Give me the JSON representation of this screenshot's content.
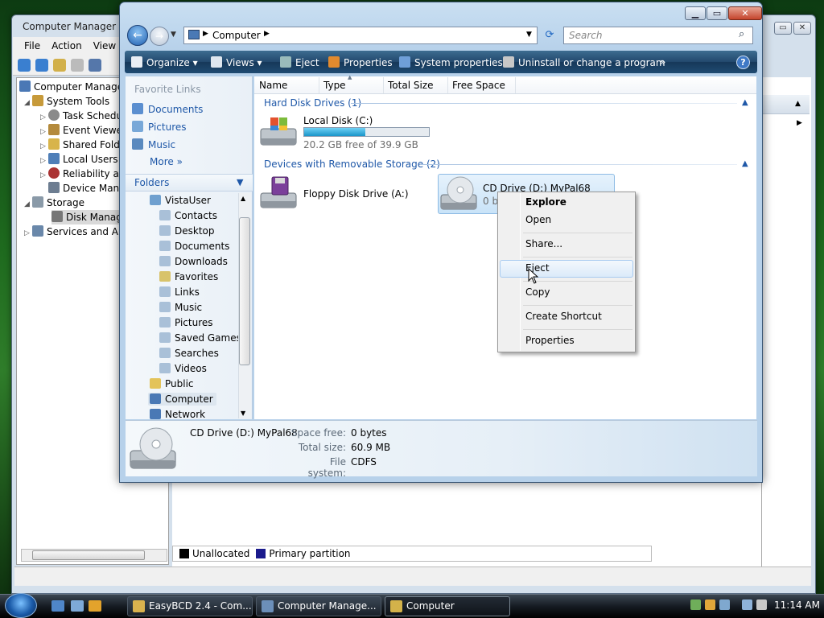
{
  "background_window": {
    "title": "Computer Manager",
    "menu": [
      "File",
      "Action",
      "View"
    ],
    "tree": [
      {
        "label": "Computer Manage",
        "level": 0
      },
      {
        "label": "System Tools",
        "level": 1
      },
      {
        "label": "Task Schedu",
        "level": 2
      },
      {
        "label": "Event Viewe",
        "level": 2
      },
      {
        "label": "Shared Fold",
        "level": 2
      },
      {
        "label": "Local Users",
        "level": 2
      },
      {
        "label": "Reliability ar",
        "level": 2
      },
      {
        "label": "Device Man",
        "level": 2
      },
      {
        "label": "Storage",
        "level": 1
      },
      {
        "label": "Disk Manag",
        "level": 2
      },
      {
        "label": "Services and Ap",
        "level": 1
      }
    ],
    "legend": [
      "Unallocated",
      "Primary partition"
    ]
  },
  "explorer": {
    "address": "Computer",
    "search_placeholder": "Search",
    "commands": [
      "Organize",
      "Views",
      "Eject",
      "Properties",
      "System properties",
      "Uninstall or change a program"
    ],
    "overflow": "»",
    "favorite_links_header": "Favorite Links",
    "favorite_links": [
      "Documents",
      "Pictures",
      "Music"
    ],
    "more_label": "More",
    "folders_label": "Folders",
    "folders": [
      "VistaUser",
      "Contacts",
      "Desktop",
      "Documents",
      "Downloads",
      "Favorites",
      "Links",
      "Music",
      "Pictures",
      "Saved Games",
      "Searches",
      "Videos",
      "Public",
      "Computer",
      "Network"
    ],
    "columns": [
      "Name",
      "Type",
      "Total Size",
      "Free Space"
    ],
    "groups": {
      "hdd": {
        "header": "Hard Disk Drives (1)",
        "drive_name": "Local Disk (C:)",
        "free_text": "20.2 GB free of 39.9 GB",
        "used_fraction": 0.49
      },
      "removable": {
        "header": "Devices with Removable Storage (2)",
        "floppy": "Floppy Disk Drive (A:)",
        "cd_name": "CD Drive (D:) MyPal68",
        "cd_sub": "0 by"
      }
    },
    "context_menu": [
      "Explore",
      "Open",
      "Share...",
      "Eject",
      "Copy",
      "Create Shortcut",
      "Properties"
    ],
    "details": {
      "name": "CD Drive (D:) MyPal68",
      "space_free_label": "Space free:",
      "space_free": "0 bytes",
      "total_size_label": "Total size:",
      "total_size": "60.9 MB",
      "file_system_label": "File system:",
      "file_system": "CDFS"
    }
  },
  "taskbar": {
    "tasks": [
      "EasyBCD 2.4 - Com...",
      "Computer Manage...",
      "Computer"
    ],
    "clock": "11:14 AM"
  }
}
